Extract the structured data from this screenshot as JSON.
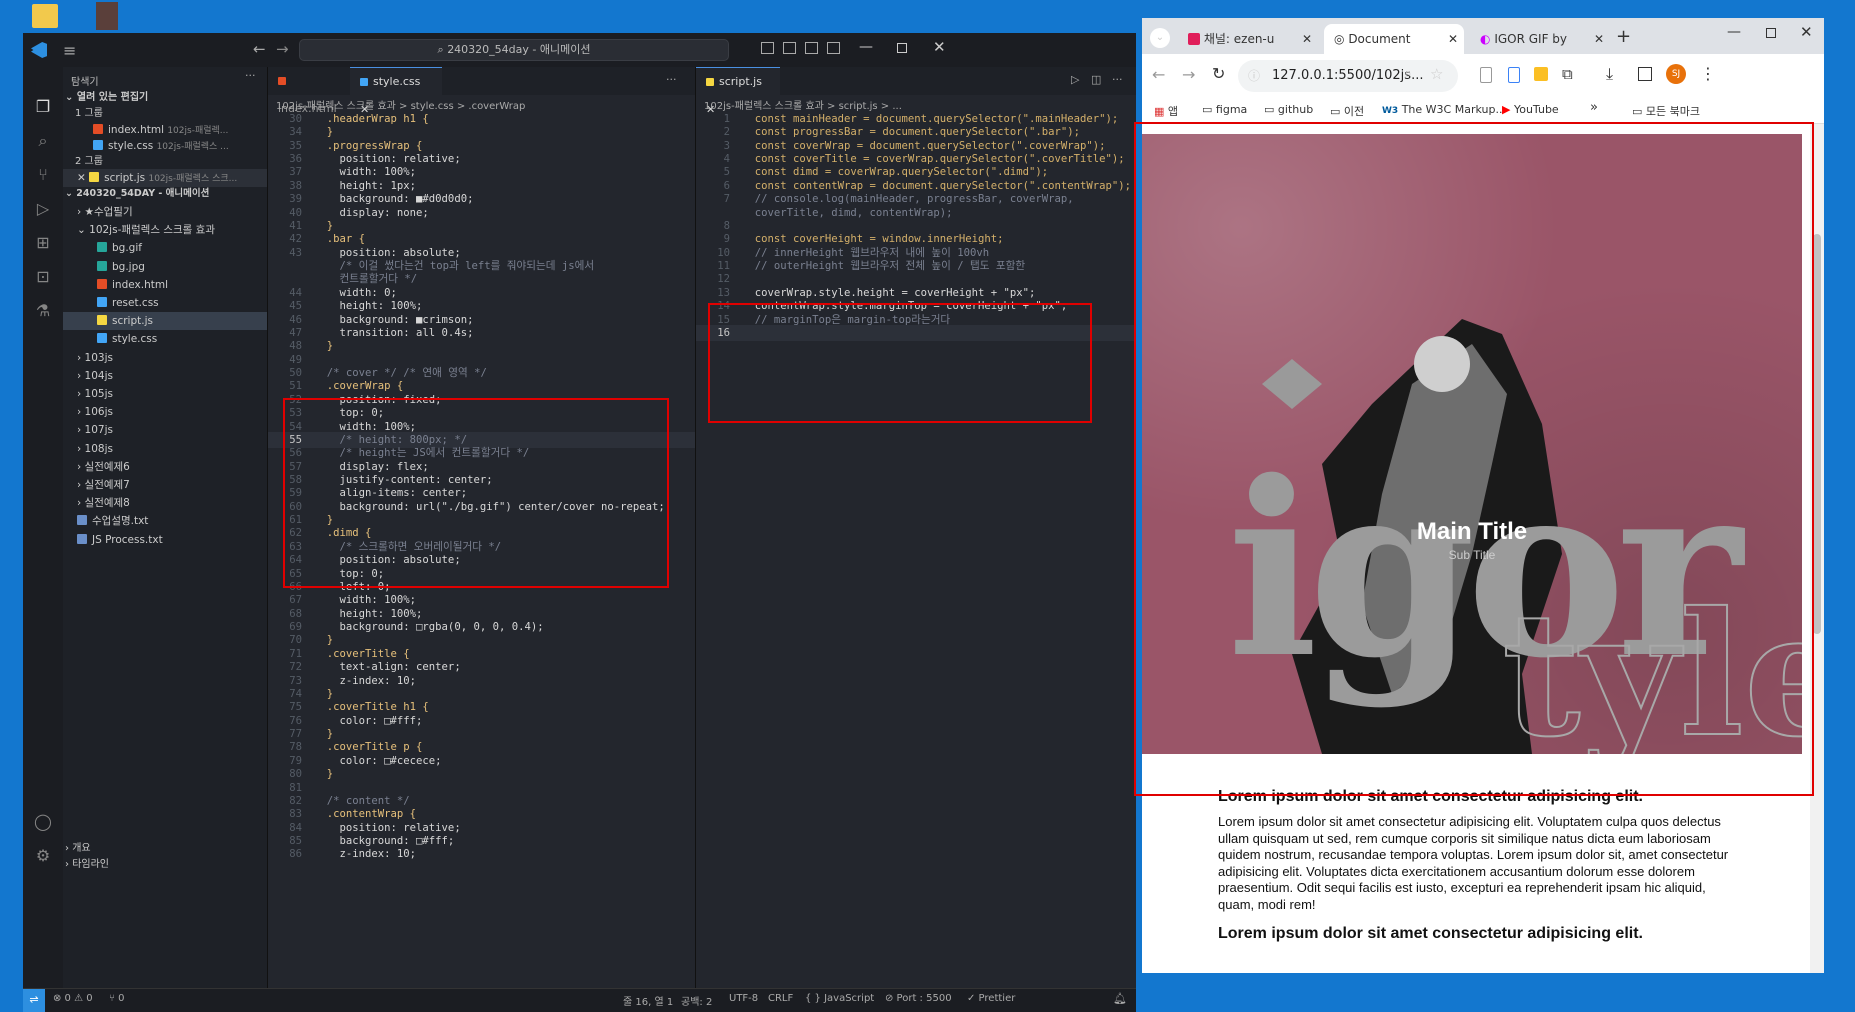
{
  "desktop": {
    "colors": {
      "bg": "#1377cf"
    }
  },
  "vscode": {
    "title": "240320_54day - 애니메이션",
    "explorer_title": "탐색기",
    "open_editors_label": "열려 있는 편집기",
    "group1_label": "1 그룹",
    "group2_label": "2 그룹",
    "open_files_g1": [
      {
        "name": "index.html",
        "path": "102js-패럴렉...",
        "icon": "html"
      },
      {
        "name": "style.css",
        "path": "102js-패럴렉스 ...",
        "icon": "css"
      }
    ],
    "open_files_g2": [
      {
        "name": "script.js",
        "path": "102js-패럴렉스 스크...",
        "icon": "js"
      }
    ],
    "workspace_label": "240320_54DAY - 애니메이션",
    "tree": [
      {
        "label": "★수업필기",
        "kind": "folder",
        "depth": 1,
        "open": false
      },
      {
        "label": "102js-패럴렉스 스크롤 효과",
        "kind": "folder",
        "depth": 1,
        "open": true
      },
      {
        "label": "bg.gif",
        "kind": "img",
        "depth": 2
      },
      {
        "label": "bg.jpg",
        "kind": "img",
        "depth": 2
      },
      {
        "label": "index.html",
        "kind": "html",
        "depth": 2
      },
      {
        "label": "reset.css",
        "kind": "css",
        "depth": 2
      },
      {
        "label": "script.js",
        "kind": "js",
        "depth": 2,
        "selected": true
      },
      {
        "label": "style.css",
        "kind": "css",
        "depth": 2
      },
      {
        "label": "103js",
        "kind": "folder",
        "depth": 1
      },
      {
        "label": "104js",
        "kind": "folder",
        "depth": 1
      },
      {
        "label": "105js",
        "kind": "folder",
        "depth": 1
      },
      {
        "label": "106js",
        "kind": "folder",
        "depth": 1
      },
      {
        "label": "107js",
        "kind": "folder",
        "depth": 1
      },
      {
        "label": "108js",
        "kind": "folder",
        "depth": 1
      },
      {
        "label": "실전예제6",
        "kind": "folder",
        "depth": 1
      },
      {
        "label": "실전예제7",
        "kind": "folder",
        "depth": 1
      },
      {
        "label": "실전예제8",
        "kind": "folder",
        "depth": 1
      },
      {
        "label": "수업설명.txt",
        "kind": "txt",
        "depth": 1
      },
      {
        "label": "JS Process.txt",
        "kind": "txt",
        "depth": 1
      }
    ],
    "outline_label": "개요",
    "timeline_label": "타임라인",
    "editor1": {
      "tabs": [
        {
          "label": "index.html",
          "active": false
        },
        {
          "label": "style.css",
          "active": true
        }
      ],
      "breadcrumb": "102js-패럴렉스 스크롤 효과 > style.css > .coverWrap",
      "lines": [
        {
          "n": "30",
          "t": "  .headerWrap h1 {"
        },
        {
          "n": "34",
          "t": "  }"
        },
        {
          "n": "35",
          "t": "  .progressWrap {"
        },
        {
          "n": "36",
          "t": "    position: relative;"
        },
        {
          "n": "37",
          "t": "    width: 100%;"
        },
        {
          "n": "38",
          "t": "    height: 1px;"
        },
        {
          "n": "39",
          "t": "    background: ■#d0d0d0;"
        },
        {
          "n": "40",
          "t": "    display: none;"
        },
        {
          "n": "41",
          "t": "  }"
        },
        {
          "n": "42",
          "t": "  .bar {"
        },
        {
          "n": "43",
          "t": "    position: absolute;"
        },
        {
          "n": "",
          "t": "    /* 이걸 썼다는건 top과 left를 줘야되는데 js에서"
        },
        {
          "n": "",
          "t": "    컨트롤할거다 */"
        },
        {
          "n": "44",
          "t": "    width: 0;"
        },
        {
          "n": "45",
          "t": "    height: 100%;"
        },
        {
          "n": "46",
          "t": "    background: ■crimson;"
        },
        {
          "n": "47",
          "t": "    transition: all 0.4s;"
        },
        {
          "n": "48",
          "t": "  }"
        },
        {
          "n": "49",
          "t": ""
        },
        {
          "n": "50",
          "t": "  /* cover */ /* 연애 영역 */"
        },
        {
          "n": "51",
          "t": "  .coverWrap {"
        },
        {
          "n": "52",
          "t": "    position: fixed;"
        },
        {
          "n": "53",
          "t": "    top: 0;"
        },
        {
          "n": "54",
          "t": "    width: 100%;"
        },
        {
          "n": "55",
          "t": "    /* height: 800px; */"
        },
        {
          "n": "56",
          "t": "    /* height는 JS에서 컨트롤할거다 */"
        },
        {
          "n": "57",
          "t": "    display: flex;"
        },
        {
          "n": "58",
          "t": "    justify-content: center;"
        },
        {
          "n": "59",
          "t": "    align-items: center;"
        },
        {
          "n": "60",
          "t": "    background: url(\"./bg.gif\") center/cover no-repeat;"
        },
        {
          "n": "61",
          "t": "  }"
        },
        {
          "n": "62",
          "t": "  .dimd {"
        },
        {
          "n": "63",
          "t": "    /* 스크롤하면 오버레이될거다 */"
        },
        {
          "n": "64",
          "t": "    position: absolute;"
        },
        {
          "n": "65",
          "t": "    top: 0;"
        },
        {
          "n": "66",
          "t": "    left: 0;"
        },
        {
          "n": "67",
          "t": "    width: 100%;"
        },
        {
          "n": "68",
          "t": "    height: 100%;"
        },
        {
          "n": "69",
          "t": "    background: □rgba(0, 0, 0, 0.4);"
        },
        {
          "n": "70",
          "t": "  }"
        },
        {
          "n": "71",
          "t": "  .coverTitle {"
        },
        {
          "n": "72",
          "t": "    text-align: center;"
        },
        {
          "n": "73",
          "t": "    z-index: 10;"
        },
        {
          "n": "74",
          "t": "  }"
        },
        {
          "n": "75",
          "t": "  .coverTitle h1 {"
        },
        {
          "n": "76",
          "t": "    color: □#fff;"
        },
        {
          "n": "77",
          "t": "  }"
        },
        {
          "n": "78",
          "t": "  .coverTitle p {"
        },
        {
          "n": "79",
          "t": "    color: □#cecece;"
        },
        {
          "n": "80",
          "t": "  }"
        },
        {
          "n": "81",
          "t": ""
        },
        {
          "n": "82",
          "t": "  /* content */"
        },
        {
          "n": "83",
          "t": "  .contentWrap {"
        },
        {
          "n": "84",
          "t": "    position: relative;"
        },
        {
          "n": "85",
          "t": "    background: □#fff;"
        },
        {
          "n": "86",
          "t": "    z-index: 10;"
        }
      ]
    },
    "editor2": {
      "tabs": [
        {
          "label": "script.js",
          "active": true
        }
      ],
      "breadcrumb": "102js-패럴렉스 스크롤 효과 > script.js > ...",
      "lines": [
        {
          "n": "1",
          "t": "  const mainHeader = document.querySelector(\".mainHeader\");"
        },
        {
          "n": "2",
          "t": "  const progressBar = document.querySelector(\".bar\");"
        },
        {
          "n": "3",
          "t": "  const coverWrap = document.querySelector(\".coverWrap\");"
        },
        {
          "n": "4",
          "t": "  const coverTitle = coverWrap.querySelector(\".coverTitle\");"
        },
        {
          "n": "5",
          "t": "  const dimd = coverWrap.querySelector(\".dimd\");"
        },
        {
          "n": "6",
          "t": "  const contentWrap = document.querySelector(\".contentWrap\");"
        },
        {
          "n": "7",
          "t": "  // console.log(mainHeader, progressBar, coverWrap,"
        },
        {
          "n": "",
          "t": "  coverTitle, dimd, contentWrap);"
        },
        {
          "n": "8",
          "t": ""
        },
        {
          "n": "9",
          "t": "  const coverHeight = window.innerHeight;"
        },
        {
          "n": "10",
          "t": "  // innerHeight 웹브라우저 내에 높이 100vh"
        },
        {
          "n": "11",
          "t": "  // outerHeight 웹브라우저 전체 높이 / 탭도 포함한"
        },
        {
          "n": "12",
          "t": ""
        },
        {
          "n": "13",
          "t": "  coverWrap.style.height = coverHeight + \"px\";"
        },
        {
          "n": "14",
          "t": "  contentWrap.style.marginTop = coverHeight + \"px\";"
        },
        {
          "n": "15",
          "t": "  // marginTop은 margin-top라는거다"
        },
        {
          "n": "16",
          "t": "  "
        }
      ]
    },
    "status": {
      "errors": "⊗ 0 ⚠ 0",
      "ports": "⑂ 0",
      "position": "줄 16, 열 1",
      "spaces": "공백: 2",
      "encoding": "UTF-8",
      "eol": "CRLF",
      "language": "{ } JavaScript",
      "port": "⊘ Port : 5500",
      "prettier": "✓ Prettier"
    }
  },
  "chrome": {
    "tabs": [
      {
        "label": "채널: ezen-u",
        "active": false
      },
      {
        "label": "Document",
        "active": true
      },
      {
        "label": "IGOR GIF by",
        "active": false
      }
    ],
    "url": "127.0.0.1:5500/102js...",
    "profile_initials": "SJ",
    "bookmarks": [
      "앱",
      "figma",
      "github",
      "이전",
      "The W3C Markup...",
      "YouTube"
    ],
    "bookmarks_more": "»",
    "all_bookmarks": "모든 북마크",
    "page": {
      "cover_title": "Main Title",
      "cover_subtitle": "Sub Title",
      "poster_word": "igor",
      "poster_word2": "tyler",
      "content_heading": "Lorem ipsum dolor sit amet consectetur adipisicing elit.",
      "content_paragraph": "Lorem ipsum dolor sit amet consectetur adipisicing elit. Voluptatem culpa quos delectus ullam quisquam ut sed, rem cumque corporis sit similique natus dicta eum laboriosam quidem nostrum, recusandae tempora voluptas. Lorem ipsum dolor sit, amet consectetur adipisicing elit. Voluptates dicta exercitationem accusantium dolorum esse dolorem praesentium. Odit sequi facilis est iusto, excepturi ea reprehenderit ipsam hic aliquid, quam, modi rem!",
      "content_heading2": "Lorem ipsum dolor sit amet consectetur adipisicing elit."
    },
    "colors": {
      "cover_bg": "#9a5568",
      "annotation": "#e00000"
    }
  }
}
